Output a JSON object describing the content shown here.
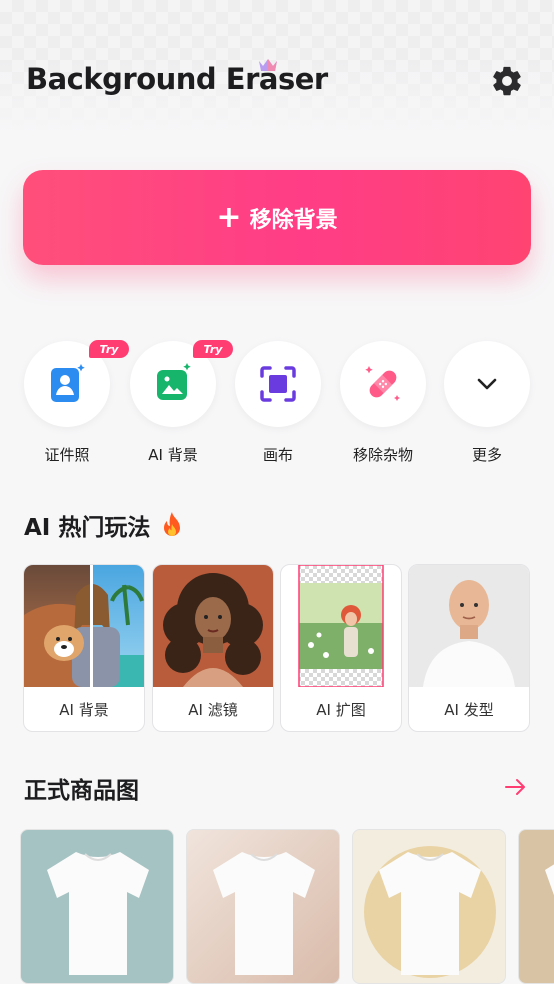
{
  "header": {
    "title": "Background Eraser",
    "crown_icon": "crown-icon",
    "settings_icon": "gear-icon"
  },
  "primary_action": {
    "label": "移除背景",
    "icon": "plus-icon",
    "gradient": [
      "#ff4f7a",
      "#ff3d86"
    ]
  },
  "tools": [
    {
      "label": "证件照",
      "icon": "id-photo-icon",
      "badge": "Try"
    },
    {
      "label": "AI 背景",
      "icon": "ai-background-icon",
      "badge": "Try"
    },
    {
      "label": "画布",
      "icon": "canvas-icon",
      "badge": ""
    },
    {
      "label": "移除杂物",
      "icon": "bandage-icon",
      "badge": ""
    },
    {
      "label": "更多",
      "icon": "chevron-down-icon",
      "badge": ""
    }
  ],
  "ai_section": {
    "title": "AI 热门玩法",
    "icon": "fire-icon",
    "cards": [
      {
        "caption": "AI 背景"
      },
      {
        "caption": "AI 滤镜"
      },
      {
        "caption": "AI 扩图"
      },
      {
        "caption": "AI 发型"
      }
    ]
  },
  "product_section": {
    "title": "正式商品图",
    "arrow_icon": "arrow-right-icon",
    "items": [
      {
        "background": "#a6c3c3"
      },
      {
        "background": "#e7d3c9"
      },
      {
        "background": "#f3ede0"
      },
      {
        "background": "#d8c3a5"
      }
    ]
  },
  "colors": {
    "accent": "#ff3d73",
    "text": "#1d1d1f",
    "page_bg": "#f7f7f8"
  }
}
